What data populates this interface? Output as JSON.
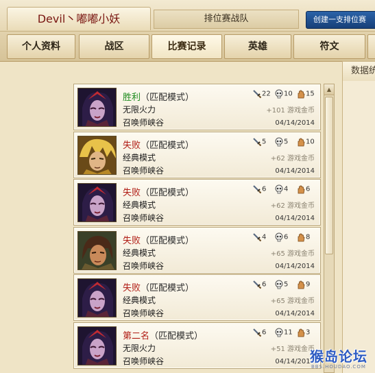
{
  "header": {
    "player_name": "Devil丶嘟嘟小妖",
    "rank_team": "排位赛战队",
    "create_team_button": "创建一支排位赛"
  },
  "tabs": [
    {
      "label": "个人资料",
      "active": false
    },
    {
      "label": "战区",
      "active": false
    },
    {
      "label": "比赛记录",
      "active": true
    },
    {
      "label": "英雄",
      "active": false
    },
    {
      "label": "符文",
      "active": false
    }
  ],
  "stats_tab": "数据统",
  "colors": {
    "win": "#1d8a1d",
    "loss": "#b01c14",
    "second": "#b01c14",
    "accent_blue": "#173f78"
  },
  "matches": [
    {
      "result": "胜利",
      "result_type": "win",
      "queue": "（匹配模式）",
      "mode": "无限火力",
      "map": "召唤师峡谷",
      "kills": "22",
      "deaths": "10",
      "assists": "15",
      "reward": "+101 游戏金币",
      "date": "04/14/2014",
      "champion_icon": "dark-queen-portrait"
    },
    {
      "result": "失败",
      "result_type": "loss",
      "queue": "（匹配模式）",
      "mode": "经典模式",
      "map": "召唤师峡谷",
      "kills": "5",
      "deaths": "5",
      "assists": "10",
      "reward": "+62 游戏金币",
      "date": "04/14/2014",
      "champion_icon": "golden-hero-portrait"
    },
    {
      "result": "失败",
      "result_type": "loss",
      "queue": "（匹配模式）",
      "mode": "经典模式",
      "map": "召唤师峡谷",
      "kills": "6",
      "deaths": "4",
      "assists": "6",
      "reward": "+62 游戏金币",
      "date": "04/14/2014",
      "champion_icon": "dark-queen-portrait"
    },
    {
      "result": "失败",
      "result_type": "loss",
      "queue": "（匹配模式）",
      "mode": "经典模式",
      "map": "召唤师峡谷",
      "kills": "4",
      "deaths": "6",
      "assists": "8",
      "reward": "+65 游戏金币",
      "date": "04/14/2014",
      "champion_icon": "ranger-portrait"
    },
    {
      "result": "失败",
      "result_type": "loss",
      "queue": "（匹配模式）",
      "mode": "经典模式",
      "map": "召唤师峡谷",
      "kills": "6",
      "deaths": "5",
      "assists": "9",
      "reward": "+65 游戏金币",
      "date": "04/14/2014",
      "champion_icon": "dark-queen-portrait"
    },
    {
      "result": "第二名",
      "result_type": "second",
      "queue": "（匹配模式）",
      "mode": "无限火力",
      "map": "召唤师峡谷",
      "kills": "6",
      "deaths": "11",
      "assists": "3",
      "reward": "+51 游戏金币",
      "date": "04/14/2014",
      "champion_icon": "dark-queen-portrait"
    }
  ],
  "icons": {
    "kills": "sword-icon",
    "deaths": "skull-icon",
    "assists": "hand-icon"
  },
  "watermark": {
    "main": "猴岛论坛",
    "sub": "BBS.HOUDAO.COM"
  }
}
